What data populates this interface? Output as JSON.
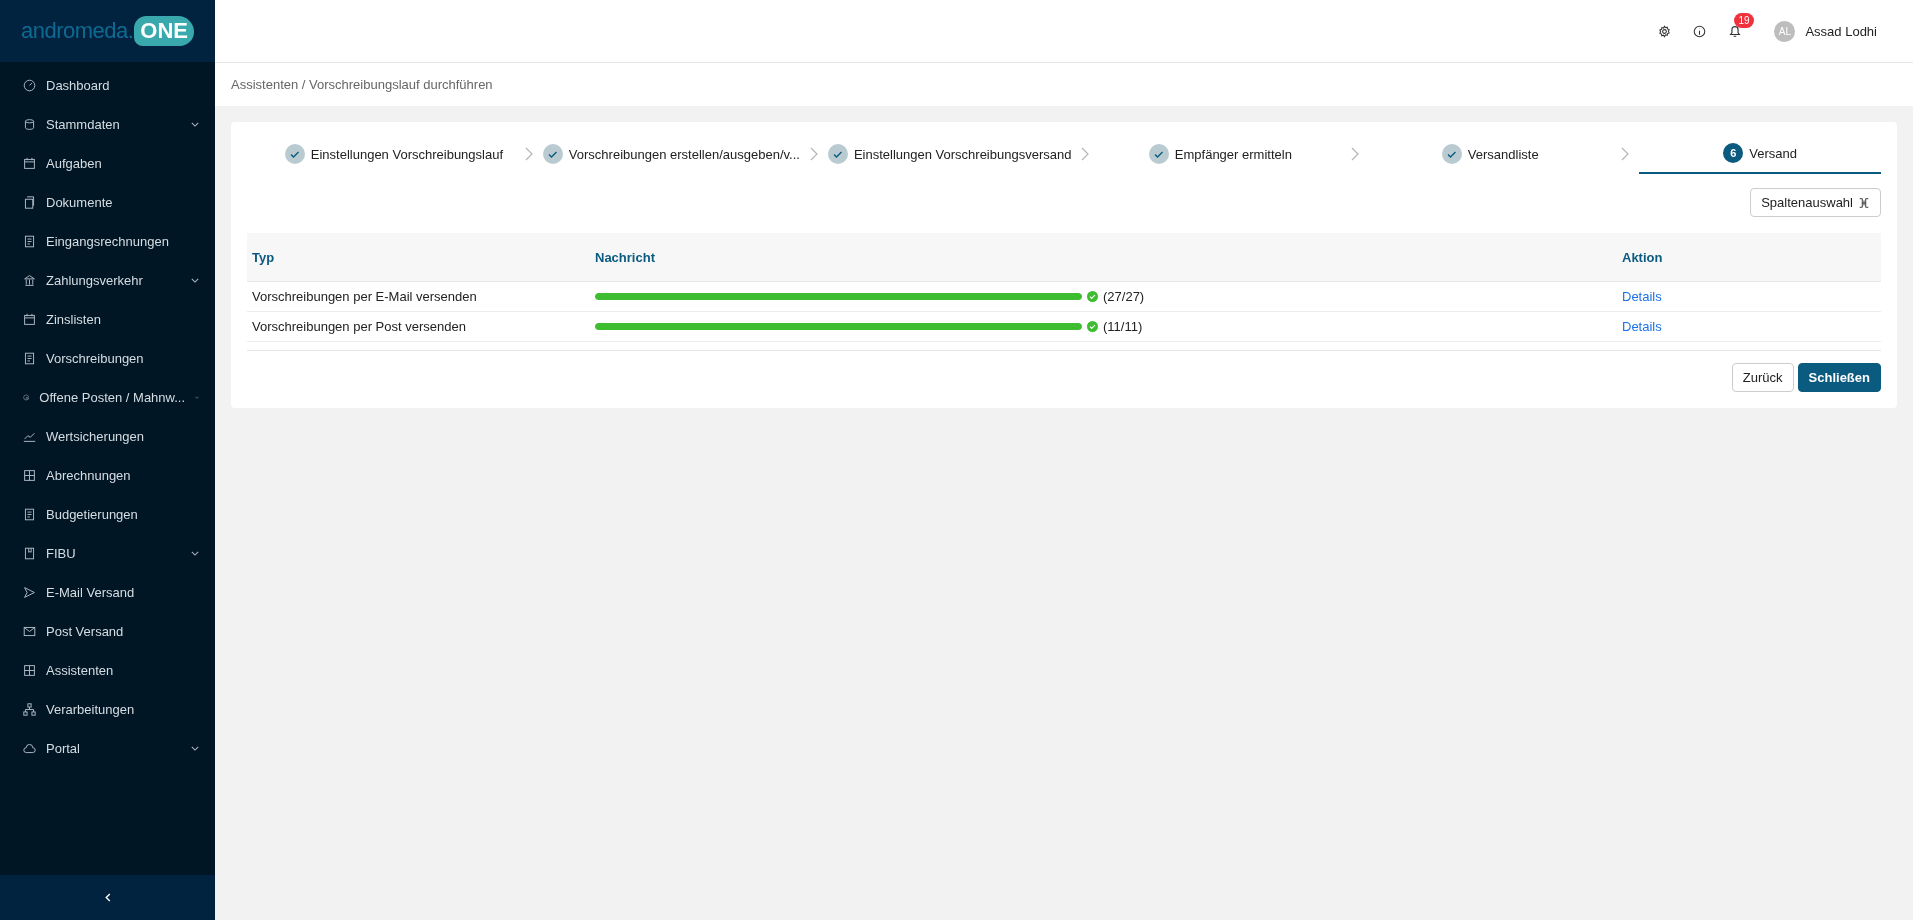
{
  "logo": {
    "word": "andromeda.",
    "badge": "ONE"
  },
  "sidebar": {
    "items": [
      {
        "label": "Dashboard",
        "expandable": false
      },
      {
        "label": "Stammdaten",
        "expandable": true
      },
      {
        "label": "Aufgaben",
        "expandable": false
      },
      {
        "label": "Dokumente",
        "expandable": false
      },
      {
        "label": "Eingangsrechnungen",
        "expandable": false
      },
      {
        "label": "Zahlungsverkehr",
        "expandable": true
      },
      {
        "label": "Zinslisten",
        "expandable": false
      },
      {
        "label": "Vorschreibungen",
        "expandable": false
      },
      {
        "label": "Offene Posten / Mahnw...",
        "expandable": true
      },
      {
        "label": "Wertsicherungen",
        "expandable": false
      },
      {
        "label": "Abrechnungen",
        "expandable": false
      },
      {
        "label": "Budgetierungen",
        "expandable": false
      },
      {
        "label": "FIBU",
        "expandable": true
      },
      {
        "label": "E-Mail Versand",
        "expandable": false
      },
      {
        "label": "Post Versand",
        "expandable": false
      },
      {
        "label": "Assistenten",
        "expandable": false
      },
      {
        "label": "Verarbeitungen",
        "expandable": false
      },
      {
        "label": "Portal",
        "expandable": true
      }
    ]
  },
  "header": {
    "notifications": "19",
    "user": {
      "initials": "AL",
      "name": "Assad Lodhi"
    }
  },
  "breadcrumb": "Assistenten / Vorschreibungslauf durchführen",
  "steps": [
    {
      "label": "Einstellungen Vorschreibungslauf",
      "completed": true,
      "selected": false
    },
    {
      "label": "Vorschreibungen erstellen/ausgeben/v...",
      "completed": true,
      "selected": false
    },
    {
      "label": "Einstellungen Vorschreibungsversand",
      "completed": true,
      "selected": false
    },
    {
      "label": "Empfänger ermitteln",
      "completed": true,
      "selected": false
    },
    {
      "label": "Versandliste",
      "completed": true,
      "selected": false
    },
    {
      "label": "Versand",
      "completed": false,
      "selected": true,
      "number": "6"
    }
  ],
  "column_button": "Spaltenauswahl",
  "table": {
    "columns": [
      "Typ",
      "Nachricht",
      "Aktion"
    ],
    "rows": [
      {
        "typ": "Vorschreibungen per E-Mail versenden",
        "level": 1,
        "count": "(27/27)",
        "action": "Details"
      },
      {
        "typ": "Vorschreibungen per Post versenden",
        "level": 1,
        "count": "(11/11)",
        "action": "Details"
      }
    ]
  },
  "buttons": {
    "back": "Zurück",
    "close": "Schließen"
  }
}
